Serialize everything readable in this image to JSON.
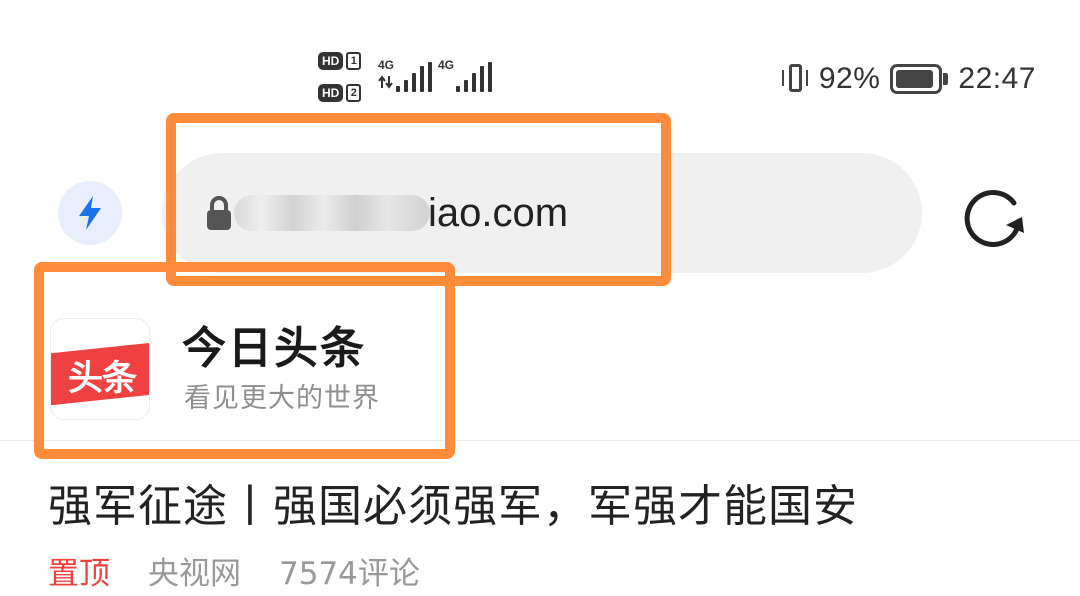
{
  "status_bar": {
    "sim1_hd": "HD",
    "sim1_num": "1",
    "sim2_hd": "HD",
    "sim2_num": "2",
    "net1": "4G",
    "net2": "4G",
    "battery_percent": "92%",
    "battery_level": 0.92,
    "time": "22:47",
    "icons": [
      "vibrate-icon",
      "signal-icon",
      "battery-icon"
    ]
  },
  "browser": {
    "url_visible": "iao.com",
    "icons": [
      "bolt-icon",
      "lock-icon",
      "refresh-icon"
    ],
    "accent_color": "#1a73e8"
  },
  "site": {
    "logo_text": "头条",
    "title": "今日头条",
    "slogan": "看见更大的世界",
    "brand_color": "#f04142"
  },
  "article": {
    "headline": "强军征途丨强国必须强军，军强才能国安",
    "pinned_label": "置顶",
    "source": "央视网",
    "comments": "7574评论"
  },
  "annotation_color": "#ff8c3a"
}
